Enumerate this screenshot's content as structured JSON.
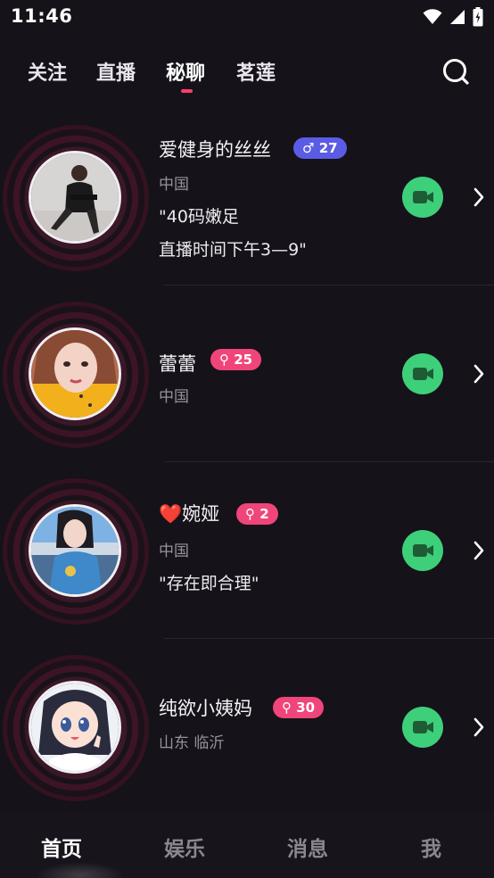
{
  "status_bar": {
    "time": "11:46"
  },
  "top_tabs": [
    {
      "label": "关注",
      "active": false
    },
    {
      "label": "直播",
      "active": false
    },
    {
      "label": "秘聊",
      "active": true
    },
    {
      "label": "茗莲",
      "active": false
    }
  ],
  "icons": {
    "search": "search-icon",
    "call": "video-camera-icon",
    "arrow": "chevron-right-icon"
  },
  "colors": {
    "accent": "#ff3d6e",
    "male_badge": "#5b5ce6",
    "female_badge": "#f0457a",
    "call_button": "#3ecf7b"
  },
  "users": [
    {
      "name": "爱健身的丝丝",
      "gender": "♂",
      "age": "27",
      "location": "中国",
      "bio": [
        "\"40码嫩足",
        "直播时间下午3—9\""
      ]
    },
    {
      "name": "蕾蕾",
      "gender": "⚲",
      "age": "25",
      "location": "中国",
      "bio": []
    },
    {
      "name": "❤️婉娅",
      "gender": "⚲",
      "age": "2",
      "location": "中国",
      "bio": [
        "\"存在即合理\""
      ]
    },
    {
      "name": "纯欲小姨妈",
      "gender": "⚲",
      "age": "30",
      "location": "山东 临沂",
      "bio": []
    }
  ],
  "bottom_nav": [
    {
      "label": "首页",
      "active": true
    },
    {
      "label": "娱乐",
      "active": false
    },
    {
      "label": "消息",
      "active": false
    },
    {
      "label": "我",
      "active": false
    }
  ]
}
